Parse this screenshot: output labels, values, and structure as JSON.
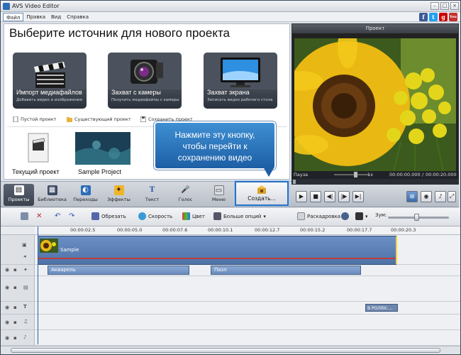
{
  "window": {
    "title": "AVS Video Editor"
  },
  "menu": [
    "Файл",
    "Правка",
    "Вид",
    "Справка"
  ],
  "social": [
    {
      "label": "f",
      "color": "#3b5998"
    },
    {
      "label": "t",
      "color": "#1da1f2"
    },
    {
      "label": "g",
      "color": "#cc0000"
    },
    {
      "label": "You",
      "color": "#c4302b"
    }
  ],
  "start": {
    "heading": "Выберите источник для нового проекта",
    "sources": [
      {
        "title": "Импорт медиафайлов",
        "sub": "Добавить видео и изображения",
        "icon": "clapperboard-icon"
      },
      {
        "title": "Захват с камеры",
        "sub": "Получить медиафайлы с камеры",
        "icon": "camcorder-icon"
      },
      {
        "title": "Захват экрана",
        "sub": "Записать видео рабочего стола",
        "icon": "monitor-icon"
      }
    ],
    "links": [
      "Пустой проект",
      "Существующий проект",
      "Сохранить проект"
    ],
    "projects": [
      "Текущий проект",
      "Sample Project"
    ]
  },
  "tooltip": {
    "line1": "Нажмите эту кнопку,",
    "line2": "чтобы перейти к",
    "line3": "сохранению видео"
  },
  "preview": {
    "header": "Проект",
    "state": "Пауза",
    "speed": "1x",
    "time_current": "00:00:00.000",
    "time_total": "00:00:20.000",
    "time_separator": "/"
  },
  "modes": [
    {
      "label": "Проекты",
      "icon": "clapperboard-icon",
      "active": true
    },
    {
      "label": "Библиотека",
      "icon": "film-library-icon"
    },
    {
      "label": "Переходы",
      "icon": "transitions-icon"
    },
    {
      "label": "Эффекты",
      "icon": "effects-icon"
    },
    {
      "label": "Текст",
      "icon": "text-icon"
    },
    {
      "label": "Голос",
      "icon": "microphone-icon"
    },
    {
      "label": "Меню",
      "icon": "menu-icon"
    }
  ],
  "create_button": "Создать...",
  "timeline": {
    "tools": {
      "trim": "Обрезать",
      "speed": "Скорость",
      "color": "Цвет",
      "more": "Больше опций",
      "storyboard": "Раскадровка",
      "zoom": "Зум:"
    },
    "ticks": [
      "00:00:02.5",
      "00:00:05.0",
      "00:00:07.6",
      "00:00:10.1",
      "00:00:12.7",
      "00:00:15.2",
      "00:00:17.7",
      "00:00:20.3"
    ],
    "video_clip": "Sample",
    "transitions": [
      "Акварель",
      "Пазл"
    ],
    "text_badge": "В РОЛЯХ:..."
  },
  "colors": {
    "accent": "#2a72c5",
    "tooltip": "#2b74bf",
    "clip": "#5b7fb6"
  }
}
